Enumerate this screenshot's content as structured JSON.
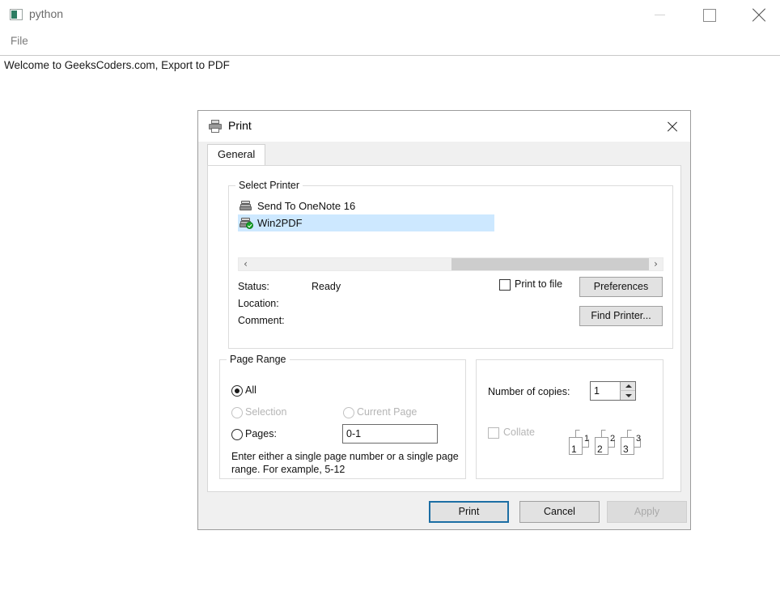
{
  "app_window": {
    "title": "python",
    "icon": "python-window-icon",
    "menu": {
      "file": "File"
    },
    "document_text": "Welcome to GeeksCoders.com, Export to PDF",
    "controls": {
      "minimize": "minimize-icon",
      "maximize": "maximize-icon",
      "close": "close-icon"
    }
  },
  "dialog": {
    "title": "Print",
    "icon": "printer-icon",
    "close_label": "close-icon",
    "tabs": [
      {
        "label": "General",
        "active": true
      }
    ],
    "select_printer": {
      "group_label": "Select Printer",
      "printers": [
        {
          "name": "Send To OneNote 16",
          "selected": false,
          "is_default": false
        },
        {
          "name": "Win2PDF",
          "selected": true,
          "is_default": true
        }
      ],
      "scroll": {
        "left_arrow": "‹",
        "right_arrow": "›"
      },
      "status": {
        "status_label": "Status:",
        "status_value": "Ready",
        "location_label": "Location:",
        "location_value": "",
        "comment_label": "Comment:",
        "comment_value": ""
      },
      "print_to_file": {
        "label": "Print to file",
        "checked": false
      },
      "buttons": {
        "preferences": "Preferences",
        "find_printer": "Find Printer..."
      }
    },
    "page_range": {
      "group_label": "Page Range",
      "options": [
        {
          "label": "All",
          "selected": true,
          "disabled": false
        },
        {
          "label": "Selection",
          "selected": false,
          "disabled": true
        },
        {
          "label": "Current Page",
          "selected": false,
          "disabled": true
        },
        {
          "label": "Pages:",
          "selected": false,
          "disabled": false
        }
      ],
      "pages_value": "0-1",
      "hint": "Enter either a single page number or a single page range.  For example, 5-12"
    },
    "copies": {
      "number_label": "Number of copies:",
      "number_value": "1",
      "collate_label": "Collate",
      "collate_checked": false,
      "collate_preview": [
        {
          "front": "1",
          "back": "1"
        },
        {
          "front": "2",
          "back": "2"
        },
        {
          "front": "3",
          "back": "3"
        }
      ]
    },
    "footer": {
      "print": "Print",
      "cancel": "Cancel",
      "apply": "Apply"
    }
  },
  "colors": {
    "selection_blue": "#cde8ff",
    "focus_border": "#1c6ea4",
    "default_printer_badge": "#16a428",
    "dialog_bg": "#f0f0f0"
  }
}
